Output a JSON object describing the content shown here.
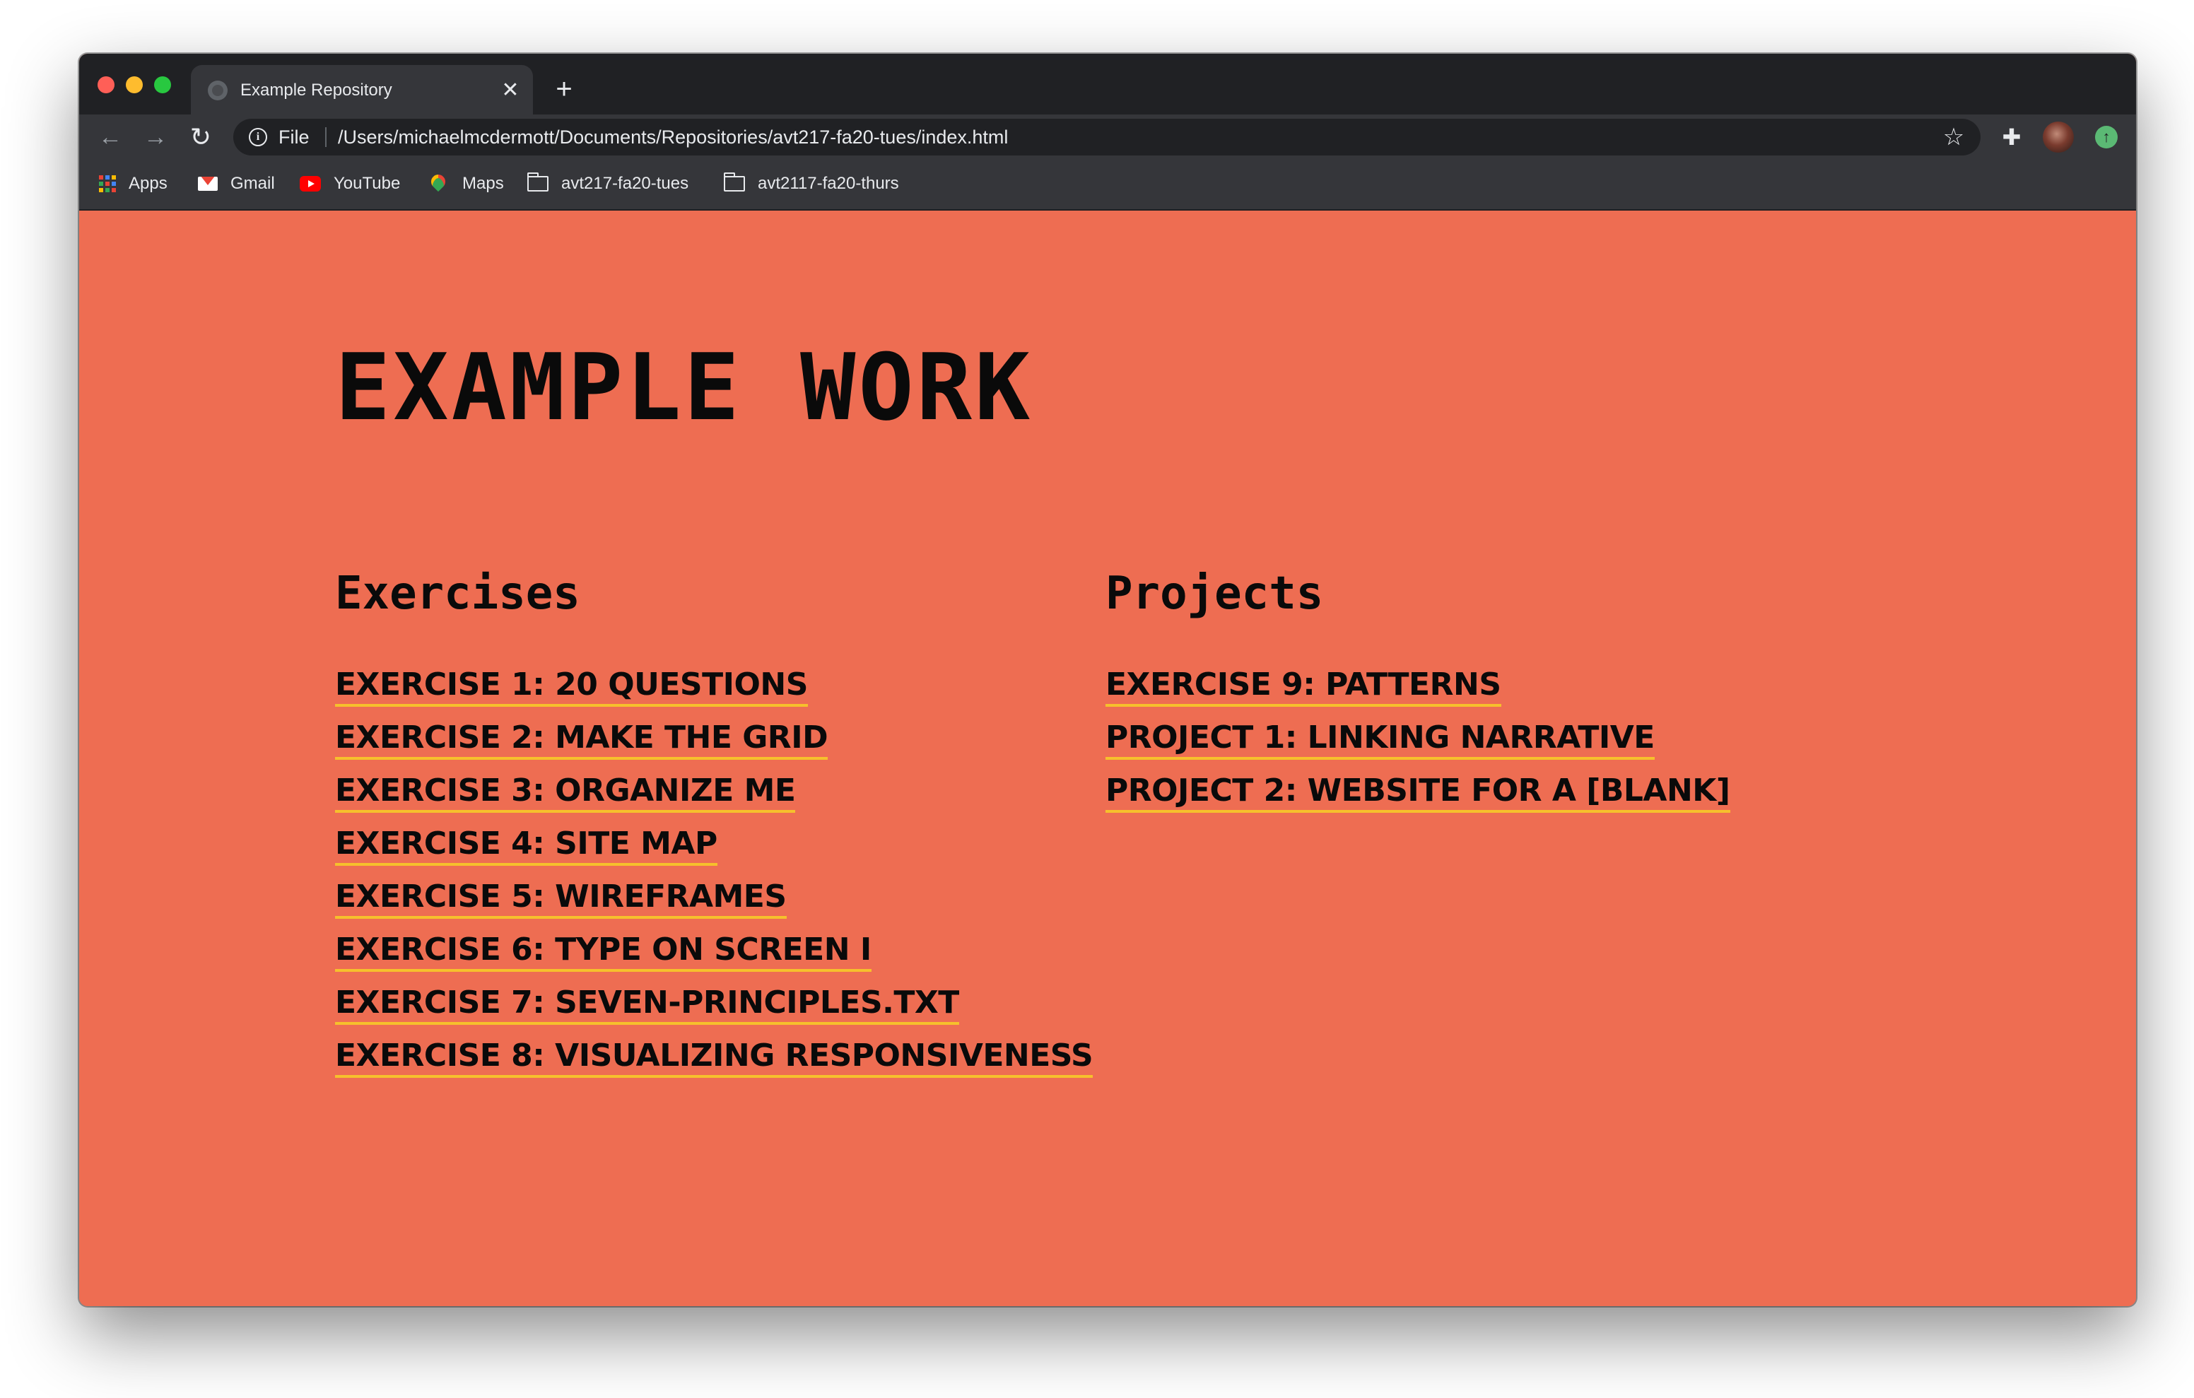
{
  "browser": {
    "tab": {
      "title": "Example Repository",
      "close_glyph": "✕"
    },
    "new_tab_glyph": "+",
    "nav": {
      "back_glyph": "←",
      "forward_glyph": "→",
      "reload_glyph": "↻"
    },
    "omnibox": {
      "scheme_label": "File",
      "url": "/Users/michaelmcdermott/Documents/Repositories/avt217-fa20-tues/index.html",
      "info_glyph": "i",
      "star_glyph": "☆"
    },
    "toolbar_icons": {
      "extensions_glyph": "✚",
      "update_glyph": "↑"
    },
    "bookmarks": [
      {
        "label": "Apps",
        "icon": "apps-grid-icon"
      },
      {
        "label": "Gmail",
        "icon": "gmail-icon"
      },
      {
        "label": "YouTube",
        "icon": "youtube-icon"
      },
      {
        "label": "Maps",
        "icon": "maps-pin-icon"
      },
      {
        "label": "avt217-fa20-tues",
        "icon": "folder-icon"
      },
      {
        "label": "avt2117-fa20-thurs",
        "icon": "folder-icon"
      }
    ]
  },
  "page": {
    "title": "EXAMPLE WORK",
    "background_color": "#ee6d52",
    "link_underline_color": "#f6c02c",
    "exercises": {
      "heading": "Exercises",
      "links": [
        "EXERCISE 1: 20 QUESTIONS",
        "EXERCISE 2: MAKE THE GRID",
        "EXERCISE 3: ORGANIZE ME",
        "EXERCISE 4: SITE MAP",
        "EXERCISE 5: WIREFRAMES",
        "EXERCISE 6: TYPE ON SCREEN I",
        "EXERCISE 7: SEVEN-PRINCIPLES.TXT",
        "EXERCISE 8: VISUALIZING RESPONSIVENESS"
      ]
    },
    "projects": {
      "heading": "Projects",
      "links": [
        "EXERCISE 9: PATTERNS",
        "PROJECT 1: LINKING NARRATIVE",
        "PROJECT 2: WEBSITE FOR A [BLANK]"
      ]
    }
  }
}
